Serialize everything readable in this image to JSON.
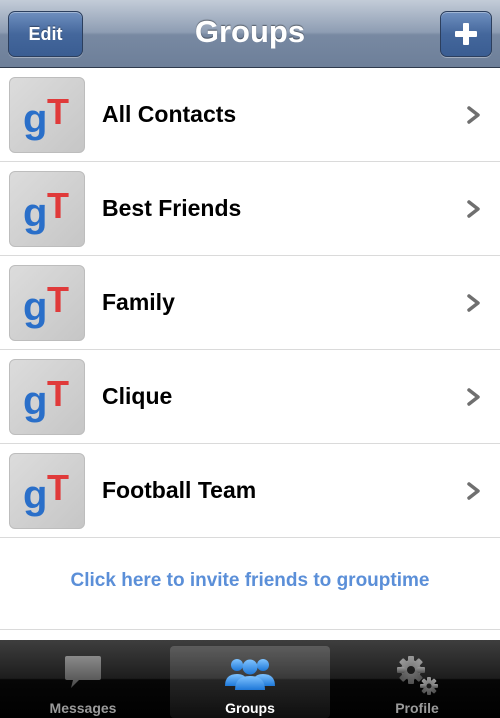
{
  "navbar": {
    "title": "Groups",
    "edit_label": "Edit",
    "add_icon": "plus-icon"
  },
  "groups": [
    {
      "name": "All Contacts",
      "icon": "grouptime-logo"
    },
    {
      "name": "Best Friends",
      "icon": "grouptime-logo"
    },
    {
      "name": "Family",
      "icon": "grouptime-logo"
    },
    {
      "name": "Clique",
      "icon": "grouptime-logo"
    },
    {
      "name": "Football Team",
      "icon": "grouptime-logo"
    }
  ],
  "invite": {
    "label": "Click here to invite friends to grouptime"
  },
  "tabbar": {
    "tabs": [
      {
        "label": "Messages",
        "icon": "speech-bubble-icon",
        "selected": false
      },
      {
        "label": "Groups",
        "icon": "people-icon",
        "selected": true
      },
      {
        "label": "Profile",
        "icon": "gears-icon",
        "selected": false
      }
    ]
  },
  "colors": {
    "accent_blue": "#3a5d92",
    "link_blue": "#5b8fd8",
    "logo_blue": "#2a6fc9",
    "logo_red": "#e03a3a"
  }
}
